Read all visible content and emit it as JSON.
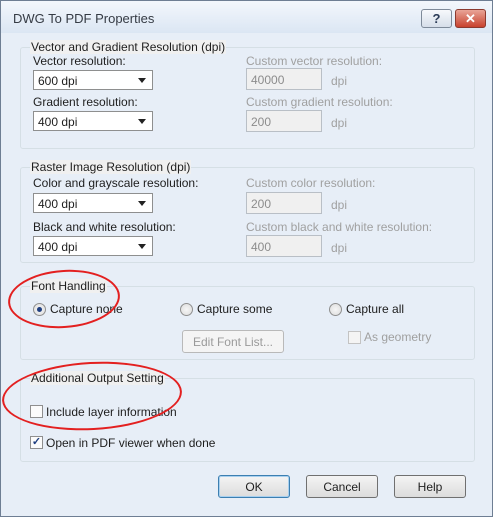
{
  "window": {
    "title": "DWG To PDF Properties",
    "help_glyph": "?",
    "close_glyph": "✕"
  },
  "vector_group": {
    "title": "Vector and Gradient Resolution (dpi)",
    "vector_label": "Vector resolution:",
    "vector_value": "600 dpi",
    "custom_vector_label": "Custom vector resolution:",
    "custom_vector_value": "40000",
    "gradient_label": "Gradient resolution:",
    "gradient_value": "400 dpi",
    "custom_gradient_label": "Custom gradient resolution:",
    "custom_gradient_value": "200",
    "unit": "dpi"
  },
  "raster_group": {
    "title": "Raster Image Resolution (dpi)",
    "color_label": "Color and grayscale resolution:",
    "color_value": "400 dpi",
    "custom_color_label": "Custom color resolution:",
    "custom_color_value": "200",
    "bw_label": "Black and white resolution:",
    "bw_value": "400 dpi",
    "custom_bw_label": "Custom black and white resolution:",
    "custom_bw_value": "400",
    "unit": "dpi"
  },
  "font_group": {
    "title": "Font Handling",
    "capture_none": "Capture none",
    "capture_some": "Capture some",
    "capture_all": "Capture all",
    "edit_font_list": "Edit Font List...",
    "as_geometry": "As geometry",
    "selected": "capture_none"
  },
  "output_group": {
    "title": "Additional Output Setting",
    "include_layer": "Include layer information",
    "include_layer_checked": false,
    "open_viewer": "Open in PDF viewer when done",
    "open_viewer_checked": true
  },
  "footer": {
    "ok": "OK",
    "cancel": "Cancel",
    "help": "Help"
  },
  "colors": {
    "annotation_red": "#e32020",
    "title_gradient_top": "#f3f7fc",
    "dialog_bg": "#f0f0f0"
  }
}
